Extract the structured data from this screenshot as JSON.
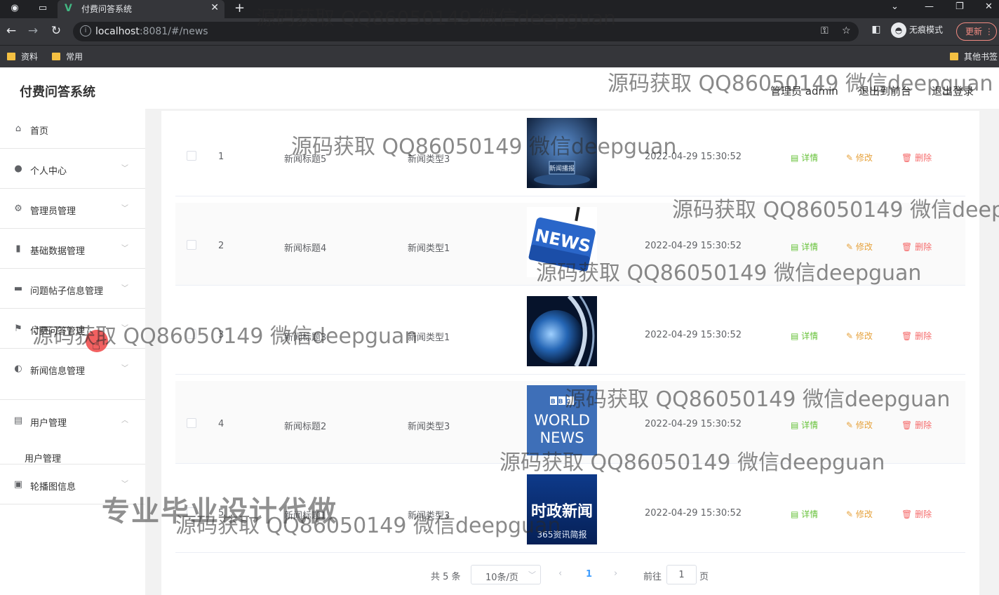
{
  "browser": {
    "tab_title": "付费问答系统",
    "url_host": "localhost",
    "url_rest": ":8081/#/news",
    "incognito_label": "无痕模式",
    "update_label": "更新",
    "bookmarks": [
      "资料",
      "常用"
    ],
    "bookmarks_right": "其他书签"
  },
  "header": {
    "brand": "付费问答系统",
    "admin": "管理员 admin",
    "back_front": "退出到前台",
    "logout": "退出登录"
  },
  "sidebar": {
    "items": [
      {
        "label": "首页",
        "icon": "home-icon"
      },
      {
        "label": "个人中心",
        "icon": "user-icon"
      },
      {
        "label": "管理员管理",
        "icon": "settings-icon"
      },
      {
        "label": "基础数据管理",
        "icon": "chart-icon"
      },
      {
        "label": "问题帖子信息管理",
        "icon": "monitor-icon"
      },
      {
        "label": "付费问答管理",
        "icon": "flag-icon"
      },
      {
        "label": "新闻信息管理",
        "icon": "globe-icon"
      },
      {
        "label": "用户管理",
        "icon": "clipboard-icon"
      },
      {
        "label": "轮播图信息",
        "icon": "image-icon"
      }
    ],
    "submenu": "用户管理"
  },
  "table": {
    "rows": [
      {
        "index": "1",
        "title": "新闻标题5",
        "type": "新闻类型3",
        "time": "2022-04-29 15:30:52",
        "image": "stage"
      },
      {
        "index": "2",
        "title": "新闻标题4",
        "type": "新闻类型1",
        "time": "2022-04-29 15:30:52",
        "image": "news"
      },
      {
        "index": "3",
        "title": "新闻标题3",
        "type": "新闻类型1",
        "time": "2022-04-29 15:30:52",
        "image": "globe"
      },
      {
        "index": "4",
        "title": "新闻标题2",
        "type": "新闻类型3",
        "time": "2022-04-29 15:30:52",
        "image": "bbc"
      },
      {
        "index": "5",
        "title": "新闻标题1",
        "type": "新闻类型3",
        "time": "2022-04-29 15:30:52",
        "image": "shizheng"
      }
    ],
    "actions": {
      "detail": "详情",
      "edit": "修改",
      "delete": "删除"
    }
  },
  "images": {
    "stage_caption": "新闻播报",
    "news_caption": "NEWS",
    "bbc_line1": "BBC",
    "bbc_line2": "WORLD",
    "bbc_line3": "NEWS",
    "shizheng_line1": "时政新闻",
    "shizheng_line2": "365资讯简报"
  },
  "pagination": {
    "total": "共 5 条",
    "page_size": "10条/页",
    "current": "1",
    "goto_label": "前往",
    "goto_value": "1",
    "page_suffix": "页"
  },
  "watermark": {
    "text": "源码获取 QQ86050149 微信deepguan",
    "promo": "专业毕业设计代做"
  },
  "colors": {
    "detail": "#67c23a",
    "edit": "#e6a23c",
    "delete": "#f56c6c",
    "active_page": "#409eff"
  }
}
